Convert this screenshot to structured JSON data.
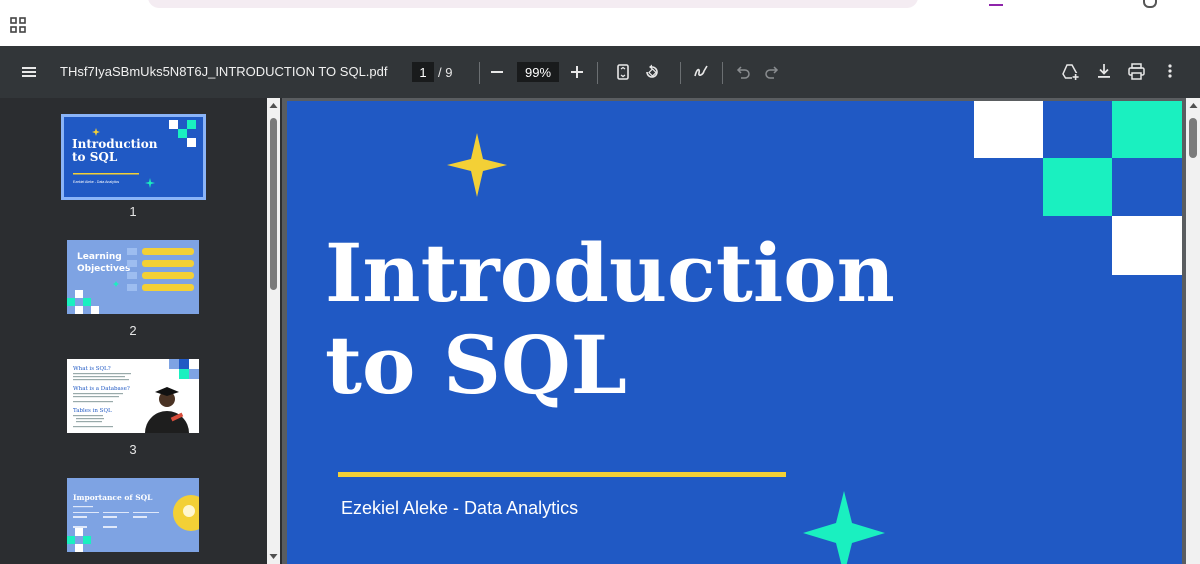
{
  "document": {
    "filename": "THsf7IyaSBmUks5N8T6J_INTRODUCTION TO SQL.pdf",
    "current_page": "1",
    "page_separator": "/ 9",
    "zoom": "99%"
  },
  "thumbnails": [
    {
      "number": "1",
      "title": "Introduction to SQL",
      "subtitle": "Ezekiel Aleke - Data Analytics"
    },
    {
      "number": "2",
      "title": "Learning Objectives"
    },
    {
      "number": "3",
      "heading1": "What is SQL?",
      "heading2": "What is a Database?",
      "heading3": "Tables in SQL"
    },
    {
      "number": "4",
      "title": "Importance of SQL"
    }
  ],
  "slide": {
    "title": "Introduction\nto SQL",
    "subtitle": "Ezekiel Aleke - Data Analytics"
  },
  "colors": {
    "toolbar": "#323639",
    "sidebar": "#2b2d30",
    "slide_bg": "#2059c4",
    "accent_teal": "#1af0c0",
    "accent_yellow": "#f3d036"
  },
  "icons": [
    "apps-grid-icon",
    "menu-icon",
    "zoom-out-icon",
    "zoom-in-icon",
    "fit-page-icon",
    "rotate-icon",
    "annotate-icon",
    "undo-icon",
    "redo-icon",
    "drive-add-icon",
    "download-icon",
    "print-icon",
    "more-icon"
  ]
}
